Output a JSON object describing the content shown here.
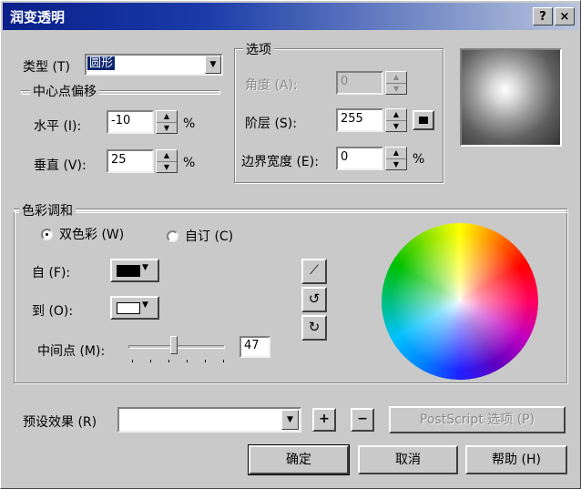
{
  "window": {
    "title": "润变透明",
    "help_btn": "?",
    "close_btn": "×"
  },
  "type": {
    "label": "类型 (T)",
    "value": "圆形"
  },
  "center_offset": {
    "group_label": "中心点偏移",
    "horizontal_label": "水平 (I):",
    "horizontal_value": "-10",
    "horizontal_unit": "%",
    "vertical_label": "垂直 (V):",
    "vertical_value": "25",
    "vertical_unit": "%"
  },
  "options": {
    "group_label": "选项",
    "angle_label": "角度 (A):",
    "angle_value": "0",
    "steps_label": "阶层 (S):",
    "steps_value": "255",
    "edge_label": "边界宽度 (E):",
    "edge_value": "0",
    "edge_unit": "%"
  },
  "color_blend": {
    "group_label": "色彩调和",
    "radio_two_color": "双色彩 (W)",
    "radio_custom": "自订 (C)",
    "from_label": "自 (F):",
    "to_label": "到 (O):",
    "midpoint_label": "中间点 (M):",
    "midpoint_value": "47",
    "midpoint_fraction": 0.47,
    "from_color": "#000000",
    "to_color": "#ffffff"
  },
  "presets": {
    "label": "预设效果 (R)",
    "value": "",
    "add": "+",
    "remove": "−",
    "postscript": "PostScript 选项 (P)"
  },
  "buttons": {
    "ok": "确定",
    "cancel": "取消",
    "help": "帮助 (H)"
  }
}
